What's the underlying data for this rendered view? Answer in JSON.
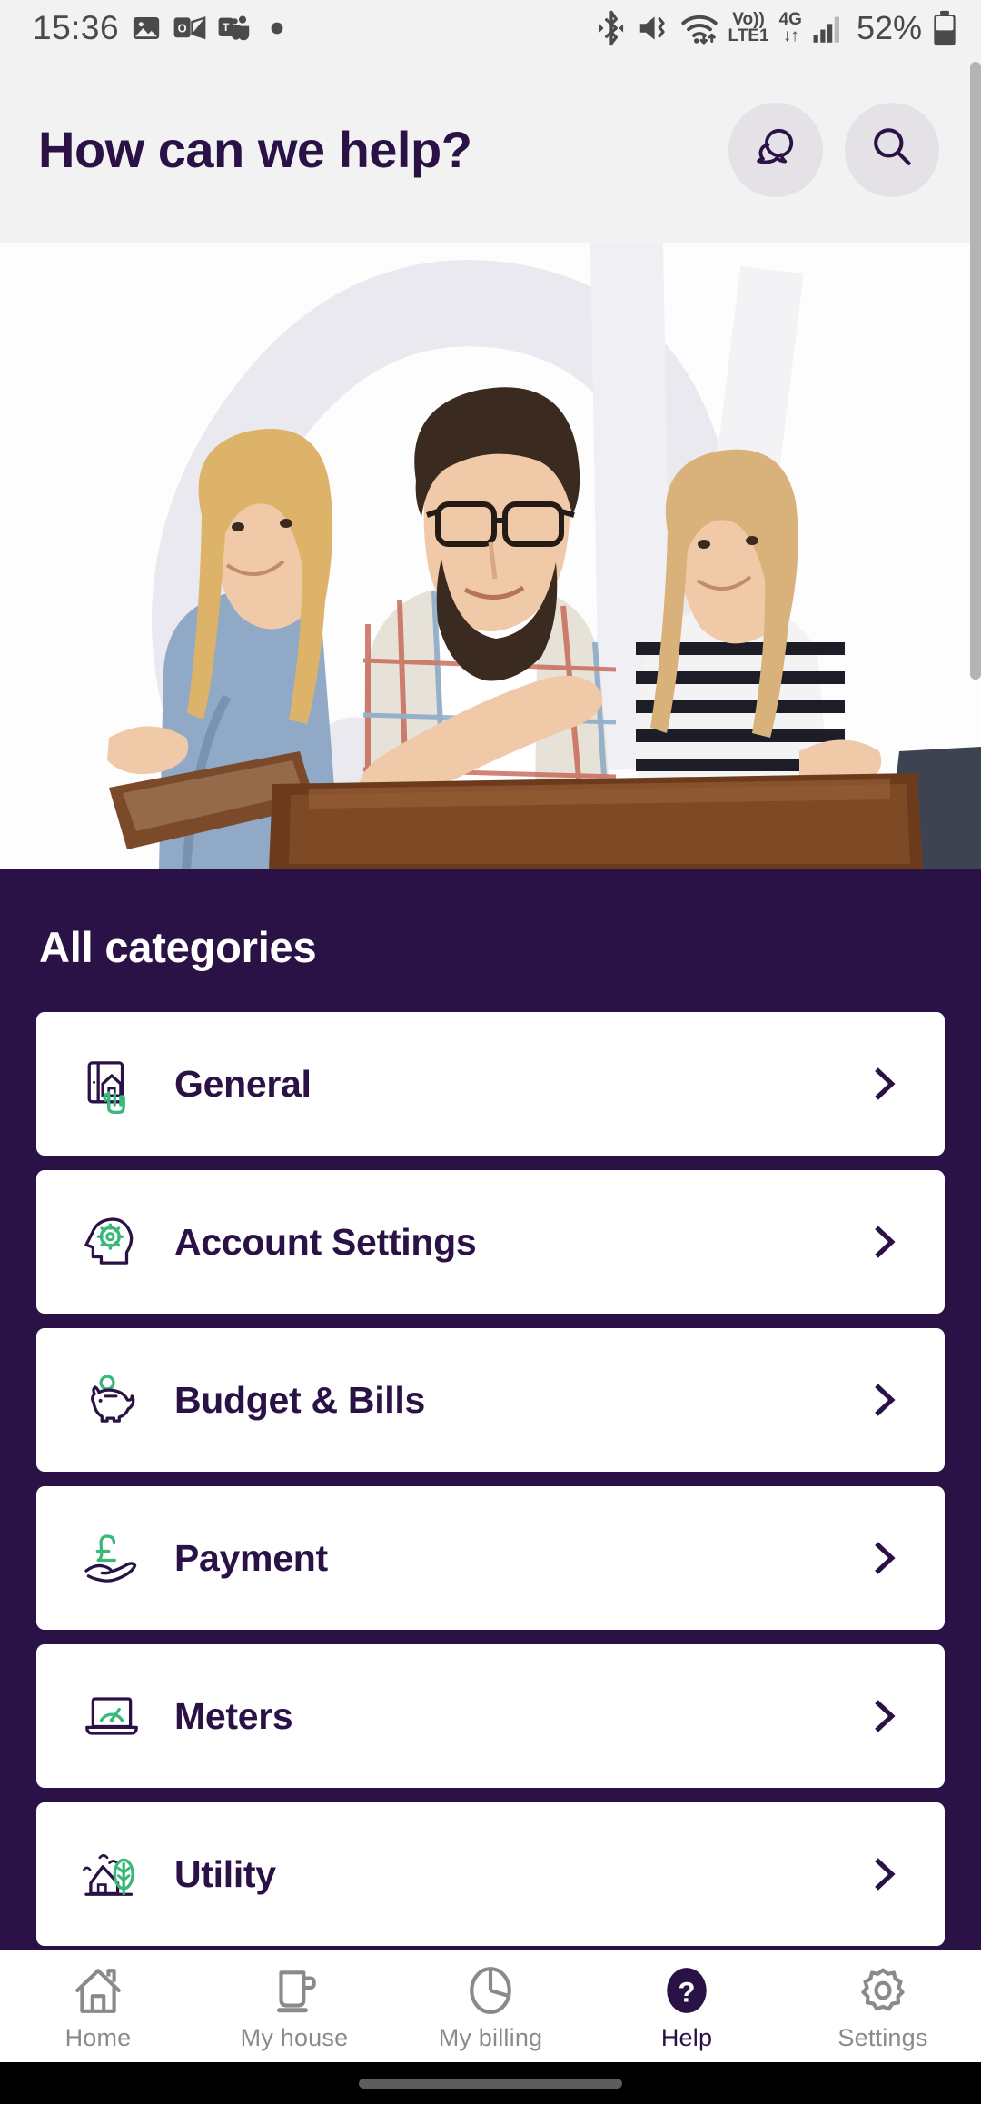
{
  "status_bar": {
    "clock": "15:36",
    "left_icons": [
      "photos-icon",
      "outlook-icon",
      "teams-icon",
      "more-dot-icon"
    ],
    "right_icons": [
      "bluetooth-icon",
      "mute-vibrate-icon",
      "wifi-icon",
      "volte-icon",
      "mobile-data-4g-icon",
      "signal-bars-icon",
      "battery-icon"
    ],
    "volte_label_top": "Vo))",
    "volte_label_bottom": "LTE1",
    "data_label_top": "4G",
    "battery_text": "52%"
  },
  "header": {
    "title": "How can we help?",
    "chat_button": "chat-bubble-icon",
    "search_button": "search-icon"
  },
  "hero": {
    "alt": "Three people sitting together looking at a tablet and a laptop"
  },
  "categories_section": {
    "heading": "All categories",
    "items": [
      {
        "label": "General",
        "icon": "house-in-frame-with-hand-icon"
      },
      {
        "label": "Account Settings",
        "icon": "head-with-gear-icon"
      },
      {
        "label": "Budget & Bills",
        "icon": "piggy-bank-with-coin-icon"
      },
      {
        "label": "Payment",
        "icon": "hand-holding-pound-icon"
      },
      {
        "label": "Meters",
        "icon": "laptop-with-gauge-icon"
      },
      {
        "label": "Utility",
        "icon": "house-with-tree-icon"
      }
    ],
    "chevron_icon": "chevron-right-icon"
  },
  "bottom_nav": {
    "items": [
      {
        "label": "Home",
        "icon": "home-icon",
        "active": false
      },
      {
        "label": "My house",
        "icon": "mug-icon",
        "active": false
      },
      {
        "label": "My billing",
        "icon": "pie-chart-icon",
        "active": false
      },
      {
        "label": "Help",
        "icon": "question-mark-circle-icon",
        "active": true
      },
      {
        "label": "Settings",
        "icon": "gear-icon",
        "active": false
      }
    ]
  },
  "colors": {
    "brand_purple": "#2b1246",
    "accent_green": "#3ab87a",
    "status_bar_bg": "#f2f2f2",
    "card_white": "#ffffff",
    "nav_inactive": "#8a8a8a"
  }
}
